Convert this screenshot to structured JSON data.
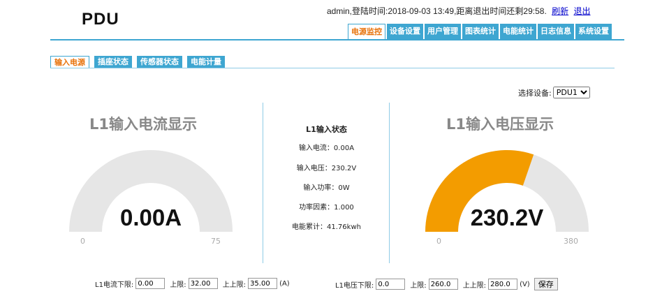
{
  "header": {
    "logo": "PDU",
    "user_info": "admin,登陆时间:2018-09-03 13:49,距离退出时间还剩29:58.",
    "refresh_link": "刷新",
    "logout_link": "退出"
  },
  "nav": {
    "items": [
      "电源监控",
      "设备设置",
      "用户管理",
      "图表统计",
      "电能统计",
      "日志信息",
      "系统设置"
    ],
    "active": "电源监控"
  },
  "subtabs": {
    "items": [
      "输入电源",
      "插座状态",
      "传感器状态",
      "电能计量"
    ],
    "active": "输入电源"
  },
  "device_select": {
    "label": "选择设备:",
    "value": "PDU1"
  },
  "current_gauge": {
    "title": "L1输入电流显示",
    "value_text": "0.00A",
    "value": 0,
    "min": "0",
    "max": "75",
    "min_value": 0,
    "max_value": 75,
    "track_color": "#e6e6e6",
    "fill_color": "#f39c00"
  },
  "voltage_gauge": {
    "title": "L1输入电压显示",
    "value_text": "230.2V",
    "value": 230.2,
    "min": "0",
    "max": "380",
    "min_value": 0,
    "max_value": 380,
    "track_color": "#e6e6e6",
    "fill_color": "#f39c00"
  },
  "status": {
    "title": "L1输入状态",
    "rows": [
      "输入电流：0.00A",
      "输入电压：230.2V",
      "输入功率：0W",
      "功率因素：1.000",
      "电能累计：41.76kwh"
    ]
  },
  "current_limits": {
    "lower_label": "L1电流下限:",
    "lower_value": "0.00",
    "upper_label": "上限:",
    "upper_value": "32.00",
    "upper_upper_label": "上上限:",
    "upper_upper_value": "35.00",
    "unit": "(A)"
  },
  "voltage_limits": {
    "lower_label": "L1电压下限:",
    "lower_value": "0.0",
    "upper_label": "上限:",
    "upper_value": "260.0",
    "upper_upper_label": "上上限:",
    "upper_upper_value": "280.0",
    "unit": "(V)",
    "save_label": "保存"
  }
}
